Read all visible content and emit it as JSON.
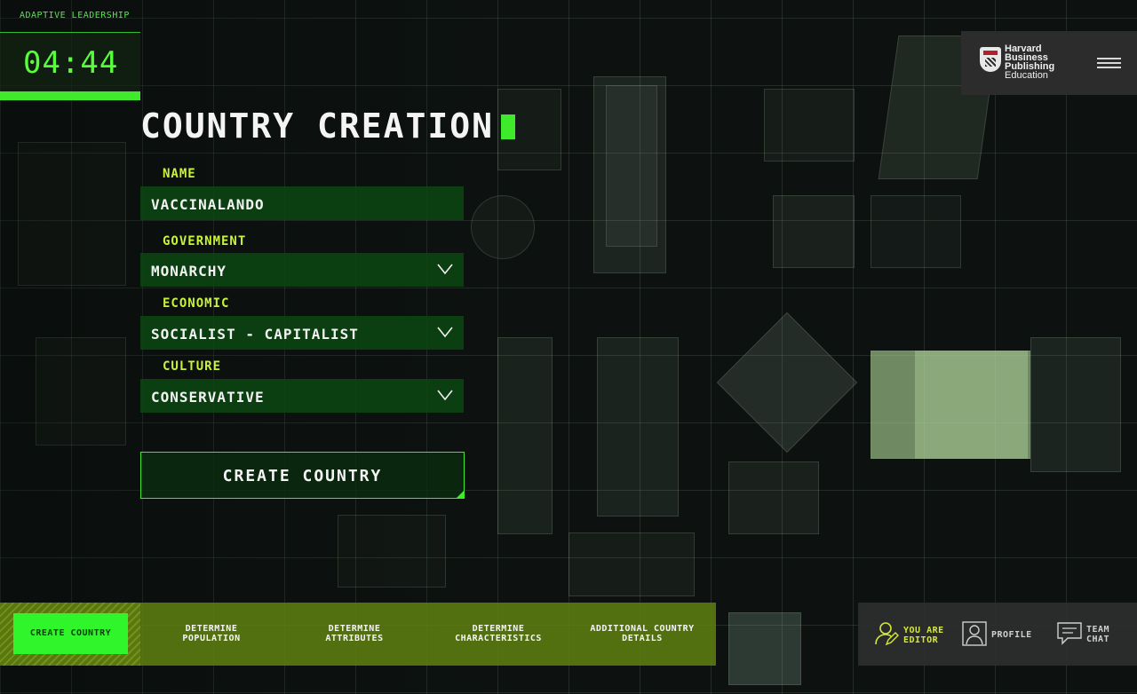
{
  "app": {
    "title": "ADAPTIVE LEADERSHIP"
  },
  "timer": {
    "value": "04:44"
  },
  "brand": {
    "line1": "Harvard",
    "line2": "Business",
    "line3": "Publishing",
    "line4": "Education"
  },
  "page": {
    "title": "COUNTRY CREATION"
  },
  "form": {
    "name": {
      "label": "NAME",
      "value": "VACCINALANDO"
    },
    "government": {
      "label": "GOVERNMENT",
      "value": "MONARCHY"
    },
    "economic": {
      "label": "ECONOMIC",
      "value": "SOCIALIST - CAPITALIST"
    },
    "culture": {
      "label": "CULTURE",
      "value": "CONSERVATIVE"
    },
    "submit_label": "CREATE COUNTRY"
  },
  "steps": [
    {
      "line1": "CREATE COUNTRY",
      "line2": ""
    },
    {
      "line1": "DETERMINE",
      "line2": "POPULATION"
    },
    {
      "line1": "DETERMINE",
      "line2": "ATTRIBUTES"
    },
    {
      "line1": "DETERMINE",
      "line2": "CHARACTERISTICS"
    },
    {
      "line1": "ADDITIONAL COUNTRY",
      "line2": "DETAILS"
    }
  ],
  "user_panel": {
    "editor": {
      "line1": "YOU ARE",
      "line2": "EDITOR"
    },
    "profile": {
      "label": "PROFILE"
    },
    "chat": {
      "line1": "TEAM",
      "line2": "CHAT"
    }
  },
  "colors": {
    "accent_green": "#3fea2c",
    "label_yellow": "#c9f23a",
    "steps_bg": "#60801280"
  },
  "icons": [
    "menu-icon",
    "chevron-down-icon",
    "user-edit-icon",
    "profile-icon",
    "chat-icon",
    "hbp-shield-logo"
  ]
}
